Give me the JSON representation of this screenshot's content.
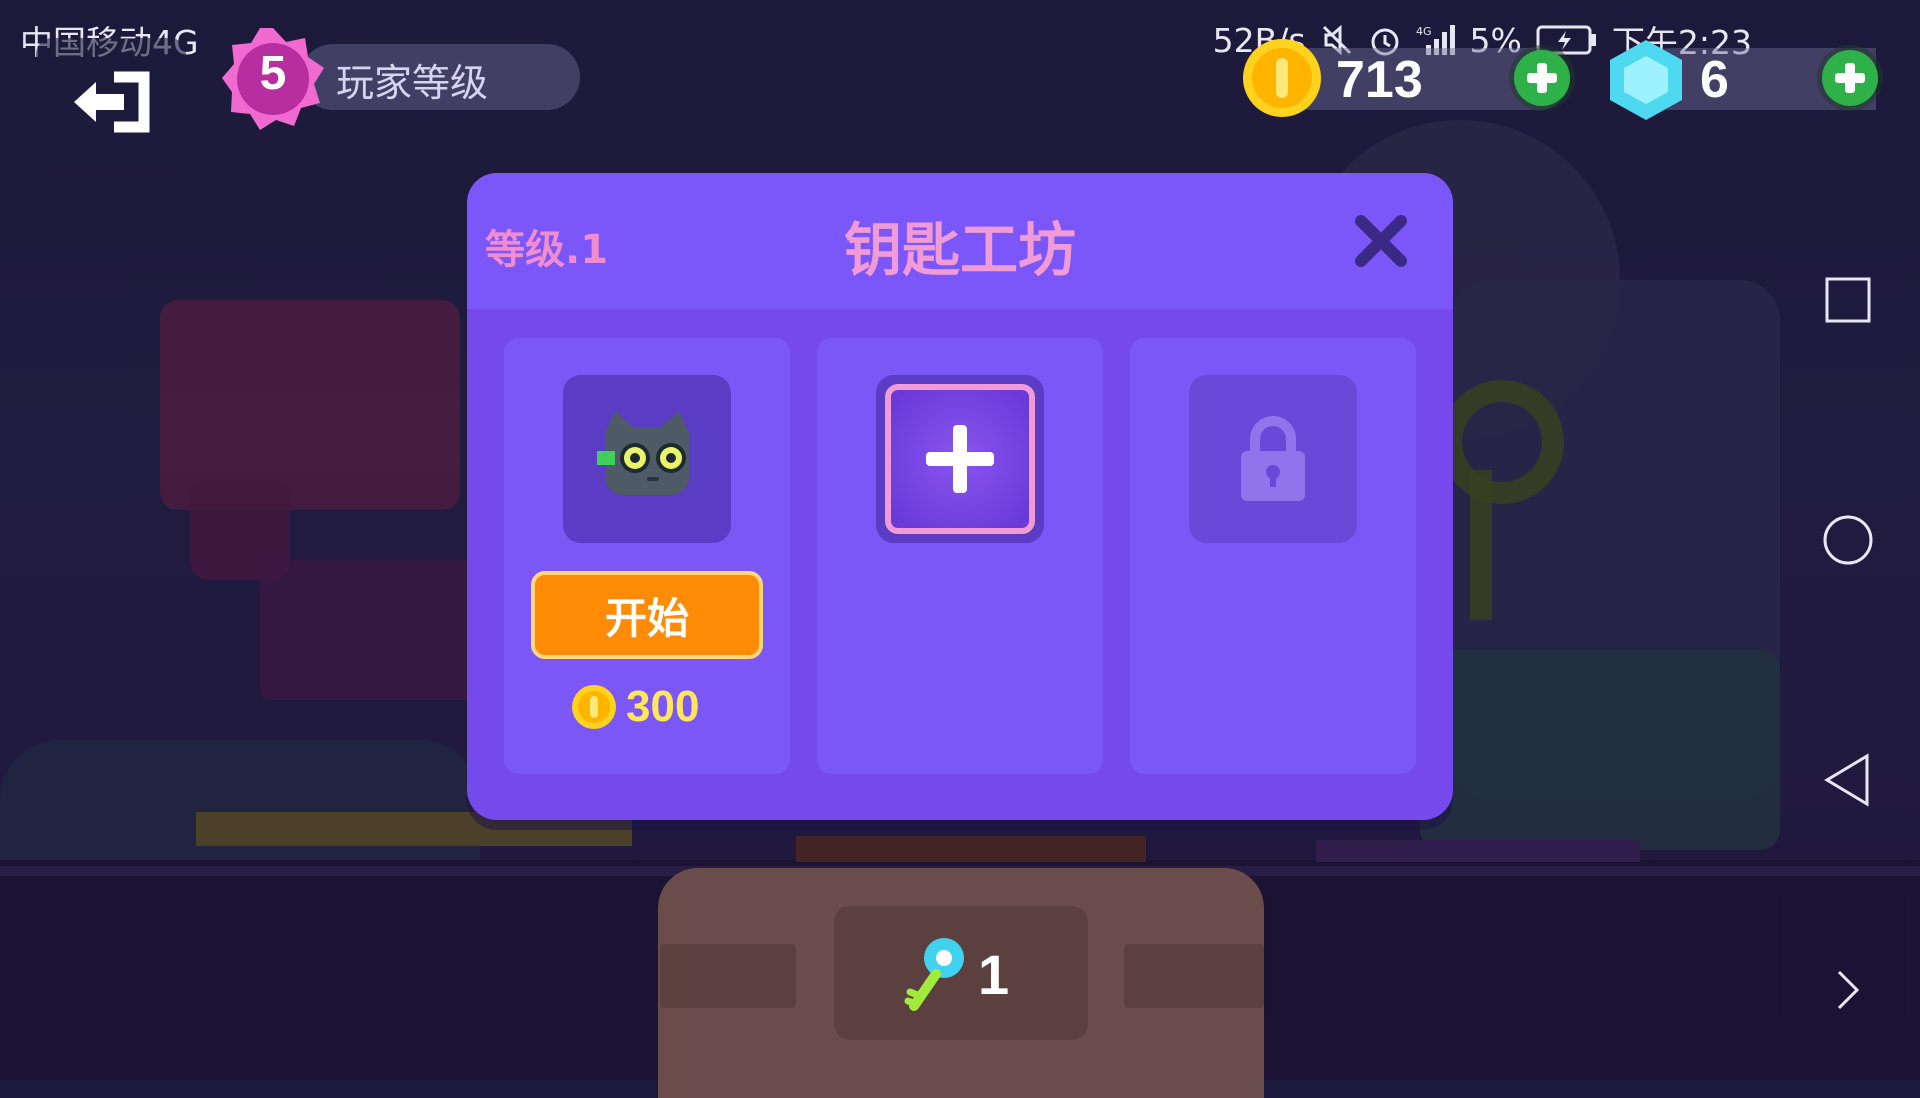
{
  "status_bar": {
    "carrier": "中国移动4G",
    "net_speed": "52B/s",
    "battery": "5%",
    "time": "下午2:23"
  },
  "hud": {
    "player_level": "5",
    "player_level_label": "玩家等级",
    "coins": "713",
    "gems": "6"
  },
  "modal": {
    "level": "等级.1",
    "title": "钥匙工坊",
    "slots": [
      {
        "state": "occupied",
        "icon": "cat-mask-icon",
        "button_label": "开始",
        "cost": "300"
      },
      {
        "state": "empty",
        "icon": "plus-icon"
      },
      {
        "state": "locked",
        "icon": "lock-icon"
      }
    ]
  },
  "tray": {
    "keys": "1"
  },
  "colors": {
    "modal_bg": "#7549ec",
    "title": "#f09ad7",
    "start_button": "#ff8b07",
    "coin": "#ffd21e",
    "gem": "#4fd9f0",
    "plus_green": "#2fb14a"
  }
}
